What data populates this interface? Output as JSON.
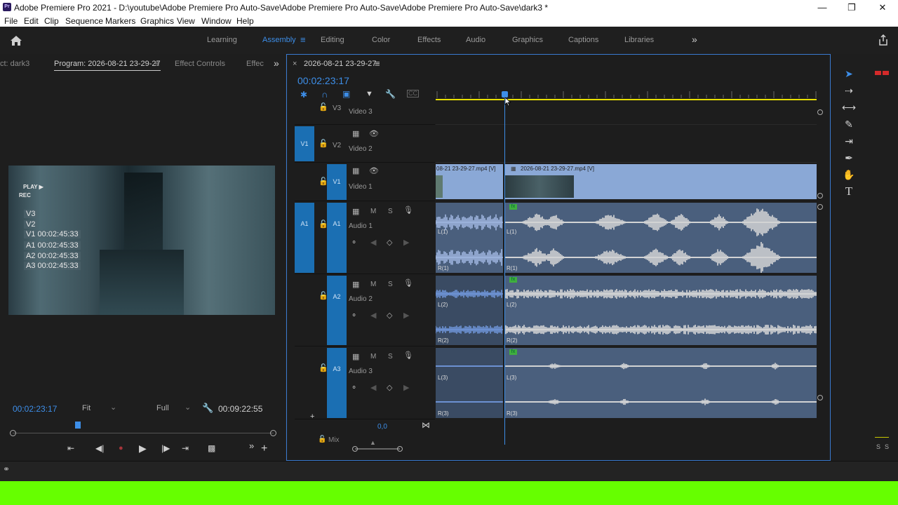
{
  "window": {
    "title": "Adobe Premiere Pro 2021 - D:\\youtube\\Adobe Premiere Pro Auto-Save\\Adobe Premiere Pro Auto-Save\\Adobe Premiere Pro Auto-Save\\dark3 *",
    "app_icon": "Pr"
  },
  "menu": [
    "File",
    "Edit",
    "Clip",
    "Sequence",
    "Markers",
    "Graphics",
    "View",
    "Window",
    "Help"
  ],
  "workspaces": {
    "learning": "Learning",
    "assembly": "Assembly",
    "editing": "Editing",
    "color": "Color",
    "effects": "Effects",
    "audio": "Audio",
    "graphics": "Graphics",
    "captions": "Captions",
    "libraries": "Libraries",
    "more": "»"
  },
  "left_tabs": {
    "project": "ct: dark3",
    "program": "Program: 2026-08-21 23-29-27",
    "effect_controls": "Effect Controls",
    "effects": "Effec"
  },
  "overlay": {
    "play": "PLAY ▶",
    "rec": "REC",
    "v3": "V3",
    "v2": "V2",
    "v1": "V1 00:02:45:33",
    "a1": "A1 00:02:45:33",
    "a2": "A2 00:02:45:33",
    "a3": "A3 00:02:45:33"
  },
  "program": {
    "timecode": "00:02:23:17",
    "fit": "Fit",
    "resolution": "Full",
    "duration": "00:09:22:55",
    "playhead_fraction": 0.25
  },
  "sequence": {
    "tab_name": "2026-08-21 23-29-27",
    "timecode": "00:02:23:17",
    "mix_value": "0,0",
    "mix_label": "Mix"
  },
  "tracks": {
    "v3": {
      "name": "V3",
      "label": "Video 3"
    },
    "v2": {
      "name": "V2",
      "label": "Video 2",
      "src": "V1"
    },
    "v1": {
      "name": "V1",
      "label": "Video 1"
    },
    "a1": {
      "name": "A1",
      "label": "Audio 1",
      "src": "A1"
    },
    "a2": {
      "name": "A2",
      "label": "Audio 2"
    },
    "a3": {
      "name": "A3",
      "label": "Audio 3"
    }
  },
  "clips": {
    "v1_left": "08-21 23-29-27.mp4 [V]",
    "v1_right": "2026-08-21 23-29-27.mp4 [V]",
    "fx": "fx"
  },
  "channels": {
    "l1": "L(1)",
    "r1": "R(1)",
    "l2": "L(2)",
    "r2": "R(2)",
    "l3": "L(3)",
    "r3": "R(3)"
  },
  "track_buttons": {
    "m": "M",
    "s": "S"
  },
  "meter": {
    "s1": "S",
    "s2": "S"
  },
  "colors": {
    "accent": "#3d8ee8",
    "target": "#1b6fb3",
    "video_clip": "#8aa8d6",
    "audio_clip": "#4a5f7d",
    "green": "#66ff00",
    "in_out": "#e8e000"
  }
}
